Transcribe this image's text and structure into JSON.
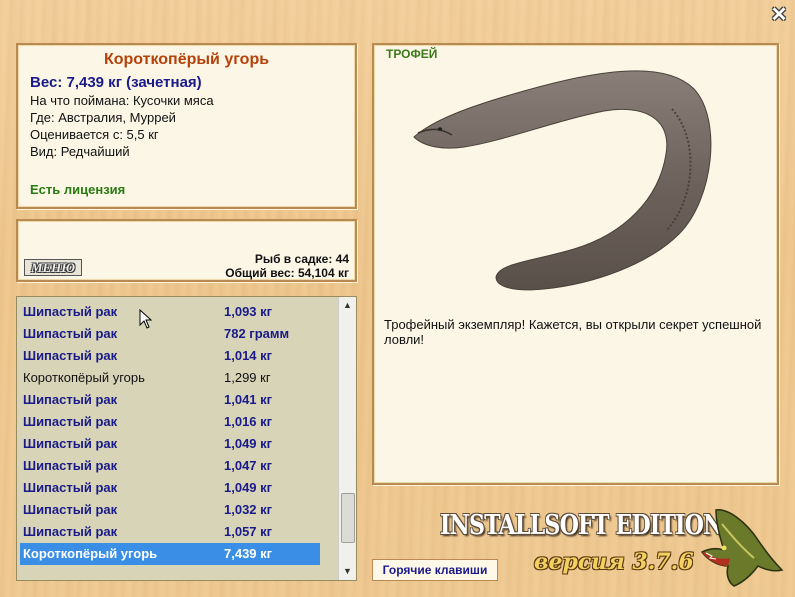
{
  "info": {
    "fish_name": "Короткопёрый угорь",
    "weight_line": "Вес: 7,439 кг (зачетная)",
    "caught_on": "На что поймана: Кусочки мяса",
    "location": "Где: Австралия, Муррей",
    "evaluated_from": "Оценивается с: 5,5 кг",
    "rarity": "Вид: Редчайший",
    "license": "Есть лицензия"
  },
  "keepnet": {
    "menu_label": "МЕНЮ",
    "fish_count": "Рыб в садке: 44",
    "total_weight": "Общий вес: 54,104 кг"
  },
  "catch_list": [
    {
      "name": "Шипастый рак",
      "weight": "1,093 кг",
      "style": "bold"
    },
    {
      "name": "Шипастый рак",
      "weight": "782 грамм",
      "style": "bold"
    },
    {
      "name": "Шипастый рак",
      "weight": "1,014 кг",
      "style": "bold"
    },
    {
      "name": "Короткопёрый угорь",
      "weight": "1,299 кг",
      "style": "plain"
    },
    {
      "name": "Шипастый рак",
      "weight": "1,041 кг",
      "style": "bold"
    },
    {
      "name": "Шипастый рак",
      "weight": "1,016 кг",
      "style": "bold"
    },
    {
      "name": "Шипастый рак",
      "weight": "1,049 кг",
      "style": "bold"
    },
    {
      "name": "Шипастый рак",
      "weight": "1,047 кг",
      "style": "bold"
    },
    {
      "name": "Шипастый рак",
      "weight": "1,049 кг",
      "style": "bold"
    },
    {
      "name": "Шипастый рак",
      "weight": "1,032 кг",
      "style": "bold"
    },
    {
      "name": "Шипастый рак",
      "weight": "1,057 кг",
      "style": "bold"
    },
    {
      "name": "Короткопёрый угорь",
      "weight": "7,439 кг",
      "style": "selected"
    }
  ],
  "trophy": {
    "label": "ТРОФЕЙ",
    "description": "Трофейный экземпляр! Кажется, вы открыли секрет успешной ловли!"
  },
  "footer": {
    "hotkeys_label": "Горячие клавиши",
    "edition": "INSTALLSOFT EDITION",
    "version": "версия 3.7.6"
  },
  "icons": {
    "close": "close-icon",
    "scroll_up": "scroll-up-arrow-icon",
    "scroll_down": "scroll-down-arrow-icon",
    "pike_logo": "pike-fish-icon",
    "eel": "eel-image",
    "cursor": "mouse-cursor-icon"
  },
  "colors": {
    "fish_name": "#b5420a",
    "weight": "#1a1a8a",
    "license": "#2a7a12",
    "trophy_label": "#3c7a1a",
    "selected_row": "#3a8ee6",
    "panel_bg": "#fbf6e6",
    "list_bg": "#d8d4b8"
  }
}
